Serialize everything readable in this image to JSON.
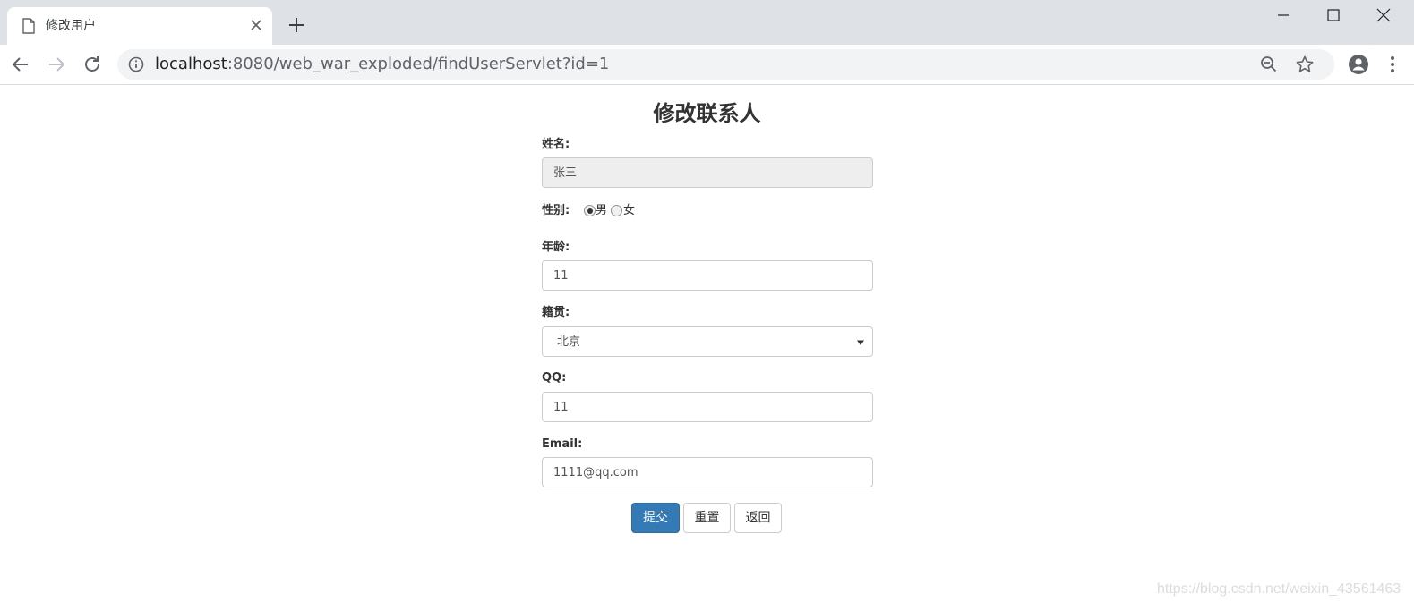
{
  "browser": {
    "tab_title": "修改用户",
    "url_host": "localhost",
    "url_rest": ":8080/web_war_exploded/findUserServlet?id=1"
  },
  "icons": [
    "file-icon",
    "close-icon",
    "plus-icon",
    "minimize-icon",
    "maximize-icon",
    "window-close-icon",
    "back-arrow-icon",
    "forward-arrow-icon",
    "reload-icon",
    "info-icon",
    "zoom-out-icon",
    "star-icon",
    "account-icon",
    "more-vertical-icon",
    "chevron-down-icon"
  ],
  "page": {
    "title": "修改联系人"
  },
  "form": {
    "name_label": "姓名:",
    "name_value": "张三",
    "gender_label": "性别:",
    "gender_male": "男",
    "gender_female": "女",
    "gender_selected": "男",
    "age_label": "年龄:",
    "age_value": "11",
    "address_label": "籍贯:",
    "address_value": "北京",
    "qq_label": "QQ:",
    "qq_value": "11",
    "email_label": "Email:",
    "email_value": "1111@qq.com"
  },
  "buttons": {
    "submit": "提交",
    "reset": "重置",
    "back": "返回"
  },
  "colors": {
    "primary_button": "#337ab7",
    "tabstrip": "#dee1e6"
  },
  "watermark": "https://blog.csdn.net/weixin_43561463"
}
